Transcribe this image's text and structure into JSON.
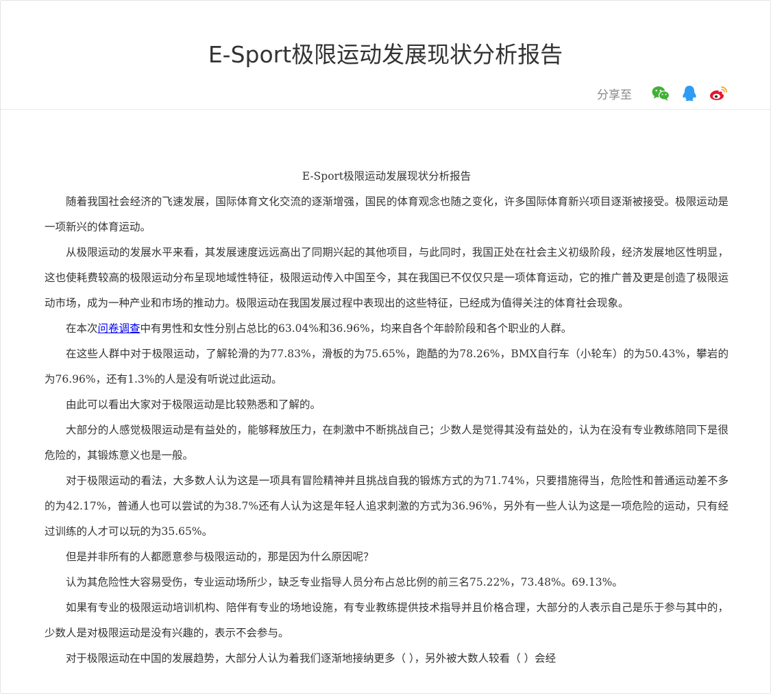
{
  "header": {
    "title": "E-Sport极限运动发展现状分析报告",
    "share_label": "分享至",
    "share_icons": [
      "wechat-icon",
      "qq-icon",
      "weibo-icon"
    ],
    "colors": {
      "wechat": "#41b035",
      "qq": "#2f9cf3",
      "weibo": "#e6162d"
    }
  },
  "article": {
    "heading": "E-Sport极限运动发展现状分析报告",
    "p1": "随着我国社会经济的飞速发展，国际体育文化交流的逐渐增强，国民的体育观念也随之变化，许多国际体育新兴项目逐渐被接受。极限运动是一项新兴的体育运动。",
    "p2": "从极限运动的发展水平来看，其发展速度远远高出了同期兴起的其他项目，与此同时，我国正处在社会主义初级阶段，经济发展地区性明显，这也使耗费较高的极限运动分布呈现地域性特征，极限运动传入中国至今，其在我国已不仅仅只是一项体育运动，它的推广普及更是创造了极限运动市场，成为一种产业和市场的推动力。极限运动在我国发展过程中表现出的这些特征，已经成为值得关注的体育社会现象。",
    "p3_before": "在本次",
    "p3_link": "问卷调查",
    "p3_after": "中有男性和女性分别占总比的63.04%和36.96%，均来自各个年龄阶段和各个职业的人群。",
    "p4": "在这些人群中对于极限运动，了解轮滑的为77.83%，滑板的为75.65%，跑酷的为78.26%，BMX自行车（小轮车）的为50.43%，攀岩的为76.96%，还有1.3%的人是没有听说过此运动。",
    "p5": "由此可以看出大家对于极限运动是比较熟悉和了解的。",
    "p6": "大部分的人感觉极限运动是有益处的，能够释放压力，在刺激中不断挑战自己；少数人是觉得其没有益处的，认为在没有专业教练陪同下是很危险的，其锻炼意义也是一般。",
    "p7": "对于极限运动的看法，大多数人认为这是一项具有冒险精神并且挑战自我的锻炼方式的为71.74%，只要措施得当，危险性和普通运动差不多的为42.17%，普通人也可以尝试的为38.7%还有人认为这是年轻人追求刺激的方式为36.96%，另外有一些人认为这是一项危险的运动，只有经过训练的人才可以玩的为35.65%。",
    "p8": "但是并非所有的人都愿意参与极限运动的，那是因为什么原因呢？",
    "p9": "认为其危险性大容易受伤，专业运动场所少，缺乏专业指导人员分布占总比例的前三名75.22%，73.48%。69.13%。",
    "p10": "如果有专业的极限运动培训机构、陪伴有专业的场地设施，有专业教练提供技术指导并且价格合理，大部分的人表示自己是乐于参与其中的，少数人是对极限运动是没有兴趣的，表示不会参与。",
    "p11": "对于极限运动在中国的发展趋势，大部分人认为着我们逐渐地接纳更多（        ），另外被大数人较看（    ）会经"
  }
}
